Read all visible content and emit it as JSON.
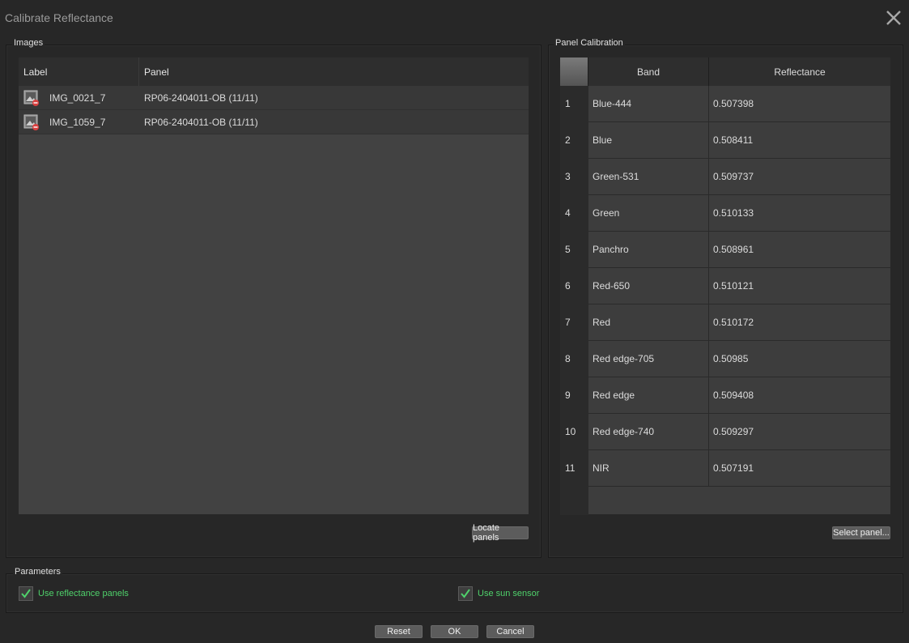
{
  "window": {
    "title": "Calibrate Reflectance"
  },
  "images": {
    "group_title": "Images",
    "columns": [
      "Label",
      "Panel"
    ],
    "rows": [
      {
        "label": "IMG_0021_7",
        "panel": "RP06-2404011-OB (11/11)"
      },
      {
        "label": "IMG_1059_7",
        "panel": "RP06-2404011-OB (11/11)"
      }
    ],
    "locate_button": "Locate panels"
  },
  "panel_calibration": {
    "group_title": "Panel Calibration",
    "columns": [
      "Band",
      "Reflectance"
    ],
    "rows": [
      {
        "num": "1",
        "band": "Blue-444",
        "reflectance": "0.507398"
      },
      {
        "num": "2",
        "band": "Blue",
        "reflectance": "0.508411"
      },
      {
        "num": "3",
        "band": "Green-531",
        "reflectance": "0.509737"
      },
      {
        "num": "4",
        "band": "Green",
        "reflectance": "0.510133"
      },
      {
        "num": "5",
        "band": "Panchro",
        "reflectance": "0.508961"
      },
      {
        "num": "6",
        "band": "Red-650",
        "reflectance": "0.510121"
      },
      {
        "num": "7",
        "band": "Red",
        "reflectance": "0.510172"
      },
      {
        "num": "8",
        "band": "Red edge-705",
        "reflectance": "0.50985"
      },
      {
        "num": "9",
        "band": "Red edge",
        "reflectance": "0.509408"
      },
      {
        "num": "10",
        "band": "Red edge-740",
        "reflectance": "0.509297"
      },
      {
        "num": "11",
        "band": "NIR",
        "reflectance": "0.507191"
      }
    ],
    "select_button": "Select panel..."
  },
  "parameters": {
    "group_title": "Parameters",
    "use_reflectance_panels": {
      "label": "Use reflectance panels",
      "checked": true
    },
    "use_sun_sensor": {
      "label": "Use sun sensor",
      "checked": true
    }
  },
  "footer": {
    "reset": "Reset",
    "ok": "OK",
    "cancel": "Cancel"
  },
  "colors": {
    "accent_check": "#4fd16b",
    "background": "#272727"
  }
}
